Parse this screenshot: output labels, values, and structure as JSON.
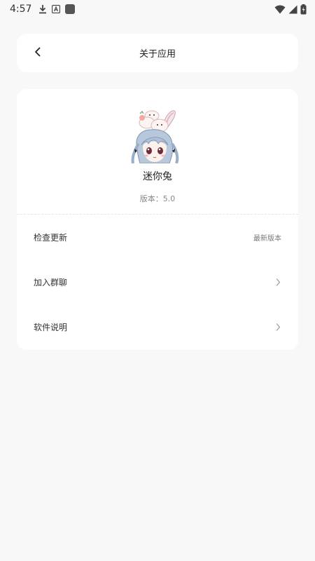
{
  "status_bar": {
    "time": "4:57",
    "left_icons": [
      "download-icon",
      "font-app-icon",
      "app-square-icon"
    ],
    "right_icons": [
      "wifi-icon",
      "signal-icon",
      "battery-charging-icon"
    ]
  },
  "header": {
    "back_icon": "chevron-left-icon",
    "title": "关于应用"
  },
  "app": {
    "name": "迷你兔",
    "version_label": "版本：",
    "version": "5.0"
  },
  "menu": [
    {
      "label": "检查更新",
      "value": "最新版本",
      "has_chevron": false
    },
    {
      "label": "加入群聊",
      "value": "",
      "has_chevron": true
    },
    {
      "label": "软件说明",
      "value": "",
      "has_chevron": true
    }
  ],
  "colors": {
    "background": "#f8f8f8",
    "card": "#ffffff",
    "text_primary": "#222222",
    "text_secondary": "#888888"
  }
}
